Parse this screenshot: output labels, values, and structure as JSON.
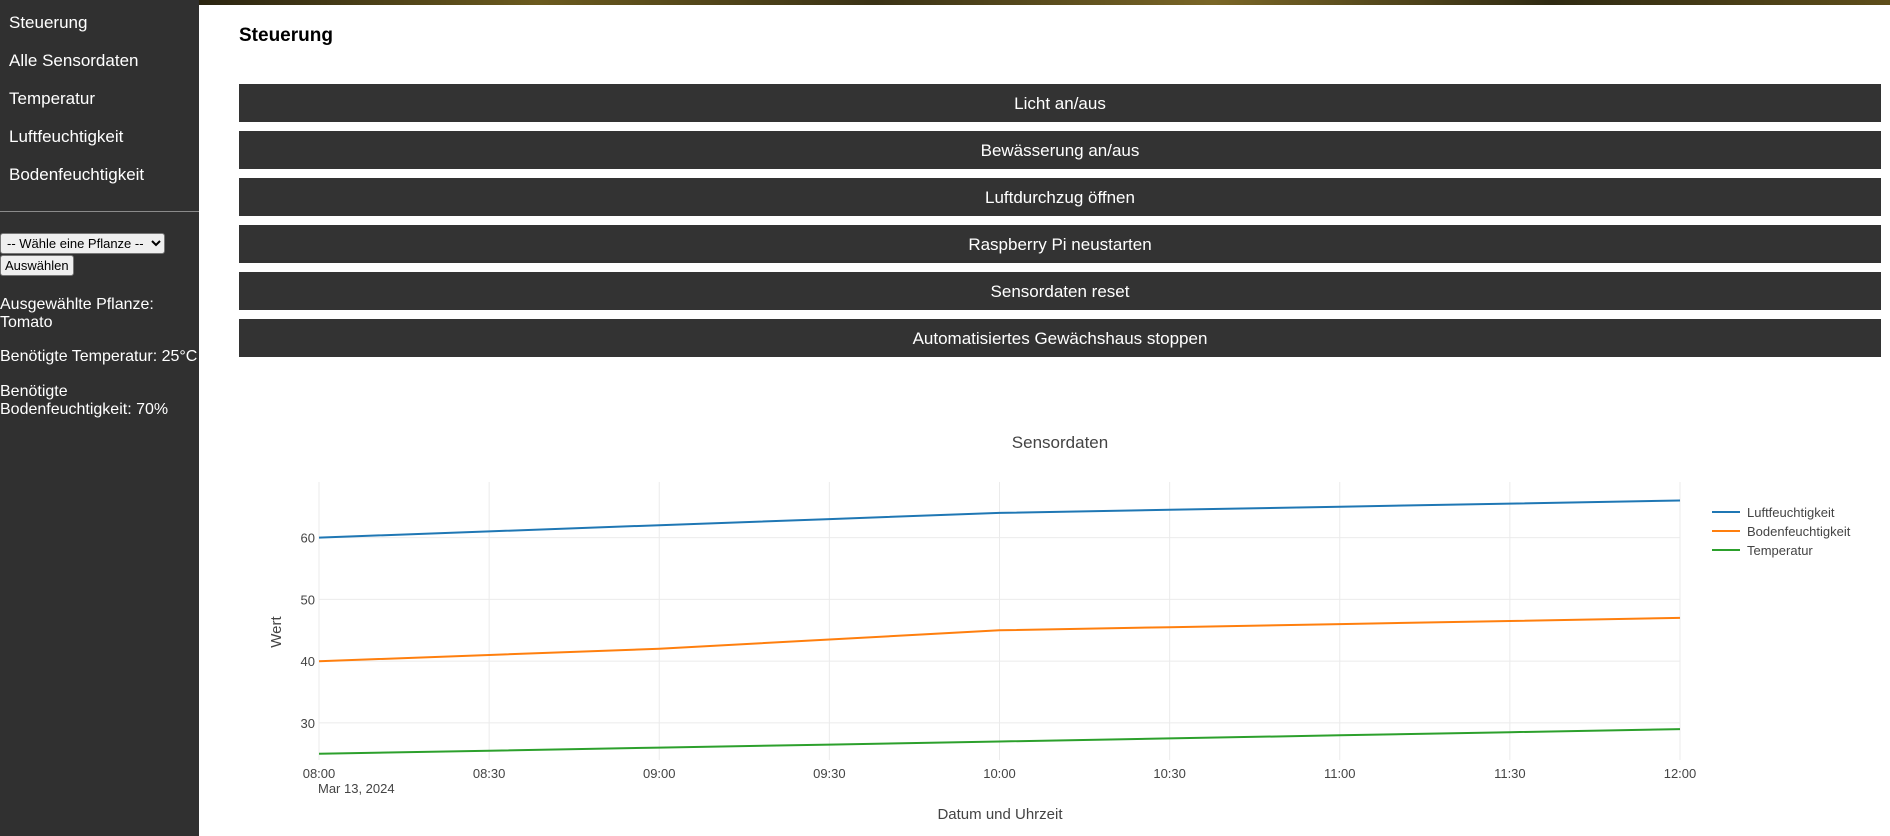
{
  "sidebar": {
    "nav": [
      "Steuerung",
      "Alle Sensordaten",
      "Temperatur",
      "Luftfeuchtigkeit",
      "Bodenfeuchtigkeit"
    ],
    "select_value": "-- Wähle eine Pflanze --",
    "select_button": "Auswählen",
    "selected_plant": "Ausgewählte Pflanze: Tomato",
    "required_temp": "Benötigte Temperatur: 25°C",
    "required_soil": "Benötigte Bodenfeuchtigkeit: 70%"
  },
  "main": {
    "title": "Steuerung",
    "buttons": [
      "Licht an/aus",
      "Bewässerung an/aus",
      "Luftdurchzug öffnen",
      "Raspberry Pi neustarten",
      "Sensordaten reset",
      "Automatisiertes Gewächshaus stoppen"
    ]
  },
  "chart_data": {
    "type": "line",
    "title": "Sensordaten",
    "xlabel": "Datum und Uhrzeit",
    "ylabel": "Wert",
    "x": [
      "08:00",
      "08:30",
      "09:00",
      "09:30",
      "10:00",
      "10:30",
      "11:00",
      "11:30",
      "12:00"
    ],
    "x_date_label": "Mar 13, 2024",
    "yticks": [
      30,
      40,
      50,
      60
    ],
    "ylim": [
      24,
      69
    ],
    "grid": true,
    "legend": "top-right",
    "series": [
      {
        "name": "Luftfeuchtigkeit",
        "color": "#1f77b4",
        "values": [
          60,
          61,
          62,
          63,
          64,
          64.5,
          65,
          65.5,
          66
        ]
      },
      {
        "name": "Bodenfeuchtigkeit",
        "color": "#ff7f0e",
        "values": [
          40,
          41,
          42,
          43.5,
          45,
          45.5,
          46,
          46.5,
          47
        ]
      },
      {
        "name": "Temperatur",
        "color": "#2ca02c",
        "values": [
          25,
          25.5,
          26,
          26.5,
          27,
          27.5,
          28,
          28.5,
          29
        ]
      }
    ]
  }
}
